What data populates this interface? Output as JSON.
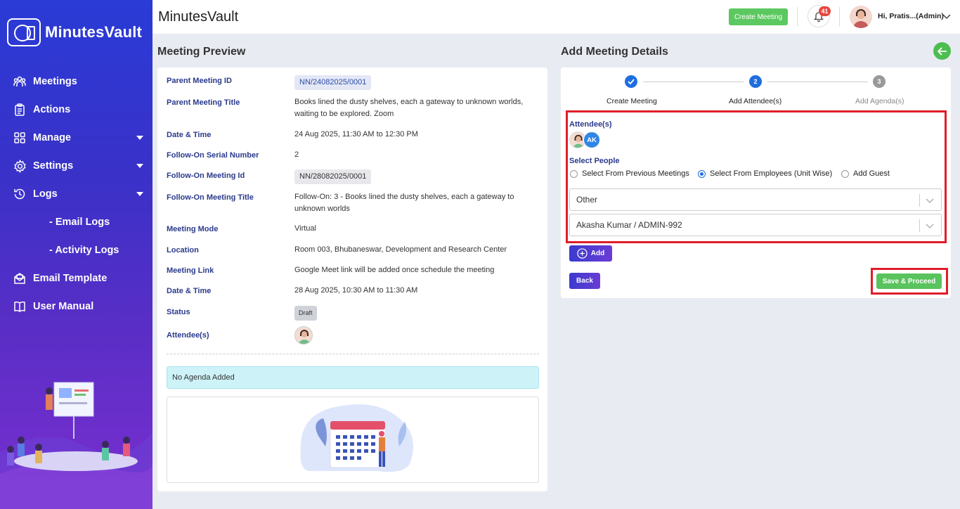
{
  "app": {
    "title": "MinutesVault",
    "logo_text": "MinutesVault"
  },
  "sidebar": {
    "items": [
      {
        "label": "Meetings",
        "icon": "users-icon"
      },
      {
        "label": "Actions",
        "icon": "clipboard-icon"
      },
      {
        "label": "Manage",
        "icon": "grid-icon",
        "has_caret": true
      },
      {
        "label": "Settings",
        "icon": "gear-icon",
        "has_caret": true
      },
      {
        "label": "Logs",
        "icon": "history-icon",
        "has_caret": true
      },
      {
        "label": "- Email Logs"
      },
      {
        "label": "- Activity Logs"
      },
      {
        "label": "Email Template",
        "icon": "mail-icon"
      },
      {
        "label": "User Manual",
        "icon": "book-icon"
      }
    ]
  },
  "header": {
    "create_meeting": "Create Meeting",
    "notification_count": "41",
    "user_name": "Hi, Pratis...(Admin)"
  },
  "preview": {
    "title": "Meeting Preview",
    "fields": {
      "parent_id_label": "Parent Meeting ID",
      "parent_id": "NN/24082025/0001",
      "parent_title_label": "Parent Meeting Title",
      "parent_title_1": "Books lined the dusty shelves, each a gateway to unknown worlds,",
      "parent_title_2": "waiting to be explored. Zoom",
      "datetime_label": "Date & Time",
      "datetime": "24 Aug 2025, 11:30 AM to 12:30 PM",
      "serial_label": "Follow-On Serial Number",
      "serial": "2",
      "follow_id_label": "Follow-On Meeting Id",
      "follow_id": "NN/28082025/0001",
      "follow_title_label": "Follow-On Meeting Title",
      "follow_title_1": "Follow-On: 3 - Books lined the dusty shelves, each a gateway to",
      "follow_title_2": "unknown worlds",
      "mode_label": "Meeting Mode",
      "mode": "Virtual",
      "location_label": "Location",
      "location": "Room 003, Bhubaneswar, Development and Research Center",
      "link_label": "Meeting Link",
      "link": "Google Meet link will be added once schedule the meeting",
      "datetime2_label": "Date & Time",
      "datetime2": "28 Aug 2025, 10:30 AM to 11:30 AM",
      "status_label": "Status",
      "status": "Draft",
      "attendees_label": "Attendee(s)"
    },
    "no_agenda": "No Agenda Added"
  },
  "add_details": {
    "title": "Add Meeting Details",
    "steps": [
      {
        "num": "",
        "label": "Create Meeting",
        "state": "done"
      },
      {
        "num": "2",
        "label": "Add Attendee(s)",
        "state": "active"
      },
      {
        "num": "3",
        "label": "Add Agenda(s)",
        "state": "pending"
      }
    ],
    "attendees_title": "Attendee(s)",
    "attendee_initials": "AK",
    "select_people_title": "Select People",
    "radio_options": [
      "Select From Previous Meetings",
      "Select From Employees (Unit Wise)",
      "Add Guest"
    ],
    "selected_radio": "Select From Employees (Unit Wise)",
    "unit_select": "Other",
    "employee_select": "Akasha Kumar / ADMIN-992",
    "add_button": "Add",
    "back_button": "Back",
    "save_button": "Save & Proceed"
  },
  "colors": {
    "accent_green": "#5cc860",
    "label_navy": "#2a3a8c",
    "highlight_red": "#e01d2a",
    "active_blue": "#2f86e6"
  }
}
